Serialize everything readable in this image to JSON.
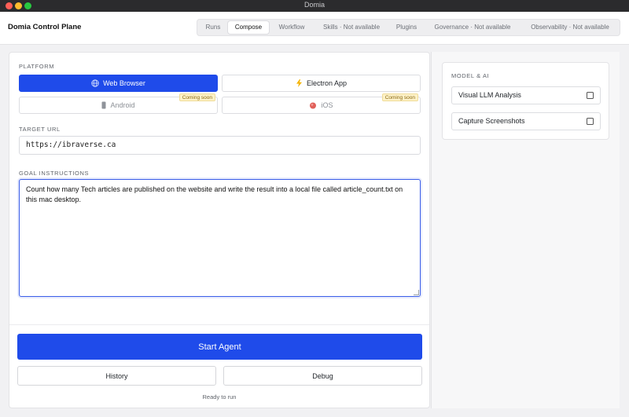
{
  "window": {
    "title": "Domia"
  },
  "header": {
    "brand": "Domia Control Plane",
    "tabs": [
      {
        "label": "Runs",
        "active": false
      },
      {
        "label": "Compose",
        "active": true
      },
      {
        "label": "Workflow",
        "active": false
      },
      {
        "label": "Skills · Not available",
        "active": false
      },
      {
        "label": "Plugins",
        "active": false
      },
      {
        "label": "Governance · Not available",
        "active": false
      },
      {
        "label": "Observability · Not available",
        "active": false
      }
    ]
  },
  "platform": {
    "label": "PLATFORM",
    "options": [
      {
        "label": "Web Browser",
        "icon": "globe-icon",
        "selected": true
      },
      {
        "label": "Electron App",
        "icon": "lightning-icon",
        "selected": false
      },
      {
        "label": "Android",
        "icon": "phone-icon",
        "selected": false,
        "badge": "Coming soon"
      },
      {
        "label": "iOS",
        "icon": "apple-icon",
        "selected": false,
        "badge": "Coming soon"
      }
    ]
  },
  "target_url": {
    "label": "TARGET URL",
    "value": "https://ibraverse.ca"
  },
  "goal": {
    "label": "GOAL INSTRUCTIONS",
    "value": "Count how many Tech articles are published on the website and write the result into a local file called article_count.txt on this mac desktop."
  },
  "actions": {
    "start": "Start Agent",
    "history": "History",
    "debug": "Debug",
    "status": "Ready to run"
  },
  "model_ai": {
    "label": "MODEL & AI",
    "options": [
      {
        "label": "Visual LLM Analysis",
        "checked": false
      },
      {
        "label": "Capture Screenshots",
        "checked": false
      }
    ]
  },
  "colors": {
    "accent": "#1f4bea",
    "badge_bg": "#fdf1c7",
    "badge_text": "#8a6a16"
  }
}
